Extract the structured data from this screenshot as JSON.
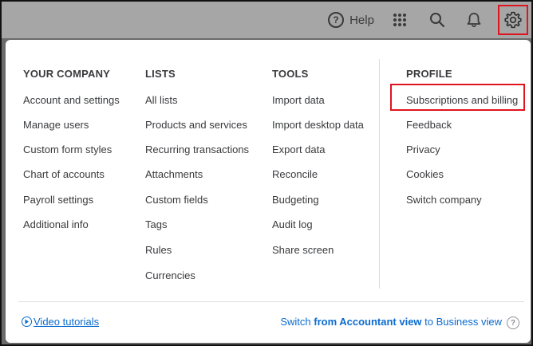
{
  "topbar": {
    "help_label": "Help",
    "help_icon_glyph": "?",
    "icons": [
      "apps-grid-icon",
      "search-icon",
      "bell-icon",
      "gear-icon"
    ]
  },
  "menu": {
    "columns": [
      {
        "heading": "YOUR COMPANY",
        "links": [
          "Account and settings",
          "Manage users",
          "Custom form styles",
          "Chart of accounts",
          "Payroll settings",
          "Additional info"
        ]
      },
      {
        "heading": "LISTS",
        "links": [
          "All lists",
          "Products and services",
          "Recurring transactions",
          "Attachments",
          "Custom fields",
          "Tags",
          "Rules",
          "Currencies"
        ]
      },
      {
        "heading": "TOOLS",
        "links": [
          "Import data",
          "Import desktop data",
          "Export data",
          "Reconcile",
          "Budgeting",
          "Audit log",
          "Share screen"
        ]
      },
      {
        "heading": "PROFILE",
        "links": [
          "Subscriptions and billing",
          "Feedback",
          "Privacy",
          "Cookies",
          "Switch company"
        ]
      }
    ],
    "highlighted": "Subscriptions and billing"
  },
  "footer": {
    "video_label": "Video tutorials",
    "switch_prefix": "Switch ",
    "switch_bold": "from Accountant view",
    "switch_suffix": " to Business view",
    "switch_help_glyph": "?"
  },
  "colors": {
    "link": "#0b6bcf",
    "text": "#393a3d",
    "highlight": "#e0141e"
  }
}
